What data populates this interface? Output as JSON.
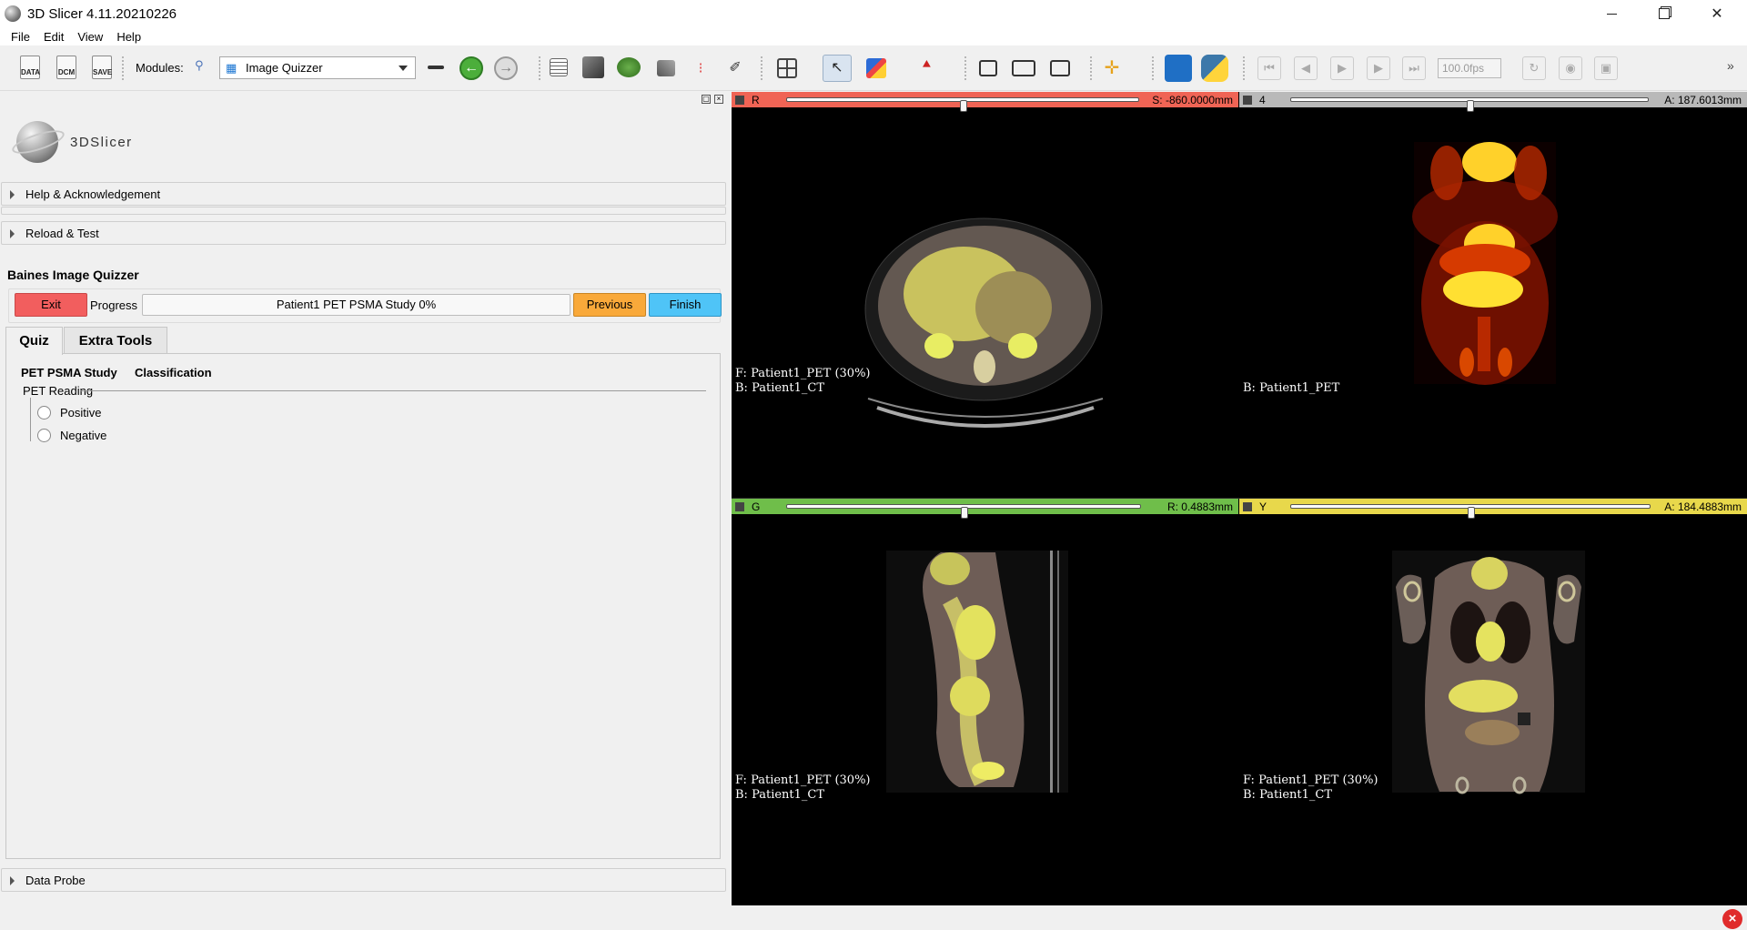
{
  "window": {
    "title": "3D Slicer 4.11.20210226"
  },
  "menu": [
    "File",
    "Edit",
    "View",
    "Help"
  ],
  "toolbar": {
    "data_label": "DATA",
    "dcm_label": "DCM",
    "save_label": "SAVE",
    "modules_label": "Modules:",
    "module_selected": "Image Quizzer",
    "fps_value": "100.0fps"
  },
  "panel": {
    "logo_text": "3DSlicer",
    "help_section": "Help & Acknowledgement",
    "reload_section": "Reload & Test",
    "quizzer_title": "Baines Image Quizzer",
    "exit_label": "Exit",
    "progress_label": "Progress",
    "progress_text": "Patient1  PET PSMA Study    0%",
    "progress_fraction": 0,
    "previous_label": "Previous",
    "finish_label": "Finish",
    "tabs": [
      "Quiz",
      "Extra Tools"
    ],
    "quiz": {
      "study_heading": "PET PSMA Study",
      "classification_heading": "Classification",
      "group_title": "PET Reading",
      "options": [
        "Positive",
        "Negative"
      ]
    },
    "data_probe_section": "Data Probe"
  },
  "views": {
    "red": {
      "letter": "R",
      "color": "#f06455",
      "offset": "S: -860.0000mm",
      "slider_fraction": 0.5,
      "overlay": [
        "F: Patient1_PET (30%)",
        "B: Patient1_CT"
      ]
    },
    "three_d": {
      "letter": "4",
      "color": "#b9b9b9",
      "offset": "A: 187.6013mm",
      "slider_fraction": 0.5,
      "overlay": [
        "B: Patient1_PET"
      ]
    },
    "green": {
      "letter": "G",
      "color": "#6fbe4a",
      "offset": "R: 0.4883mm",
      "slider_fraction": 0.5,
      "overlay": [
        "F: Patient1_PET (30%)",
        "B: Patient1_CT"
      ]
    },
    "yellow": {
      "letter": "Y",
      "color": "#e8d84b",
      "offset": "A: 184.4883mm",
      "slider_fraction": 0.5,
      "overlay": [
        "F: Patient1_PET (30%)",
        "B: Patient1_CT"
      ]
    }
  },
  "colors": {
    "exit": "#f25e5e",
    "previous": "#f9a93a",
    "finish": "#4fc4f7"
  }
}
